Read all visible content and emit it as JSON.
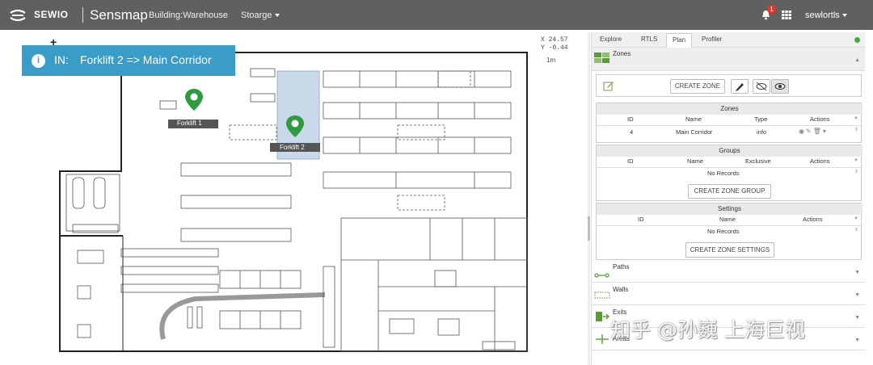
{
  "header": {
    "brand": "SEWIO",
    "app_name": "Sensmap",
    "building": "Building:Warehouse",
    "storage": "Stoarge",
    "notifications_count": "1",
    "user": "sewlortls"
  },
  "map": {
    "alert_prefix": "IN:",
    "alert_text": "Forklift 2 => Main Corridor",
    "coord_x": "X 24.57",
    "coord_y": "Y -0.44",
    "scale": "1m",
    "markers": [
      {
        "label": "Forklift 1"
      },
      {
        "label": "Forklift 2"
      }
    ]
  },
  "panel": {
    "tabs": [
      "Explore",
      "RTLS",
      "Plan",
      "Profiler"
    ],
    "active_tab": "Plan",
    "zones_section": "Zones",
    "create_zone": "CREATE ZONE",
    "zones_table": {
      "title": "Zones",
      "headers": [
        "ID",
        "Name",
        "Type",
        "Actions"
      ],
      "rows": [
        {
          "id": "4",
          "name": "Main Corridor",
          "type": "info"
        }
      ]
    },
    "groups_table": {
      "title": "Groups",
      "headers": [
        "ID",
        "Name",
        "Exclusive",
        "Actions"
      ],
      "empty": "No Records",
      "button": "CREATE ZONE GROUP"
    },
    "settings_table": {
      "title": "Settings",
      "headers": [
        "ID",
        "Name",
        "Actions"
      ],
      "empty": "No Records",
      "button": "CREATE ZONE SETTINGS"
    },
    "sections": [
      "Paths",
      "Walls",
      "Exits",
      "Areas"
    ]
  },
  "watermark": "知乎 @孙巍 上海巨视",
  "colors": {
    "topbar": "#606060",
    "alert": "#3a9dc7",
    "marker": "#2e9b3e",
    "status": "#3cb03c"
  }
}
